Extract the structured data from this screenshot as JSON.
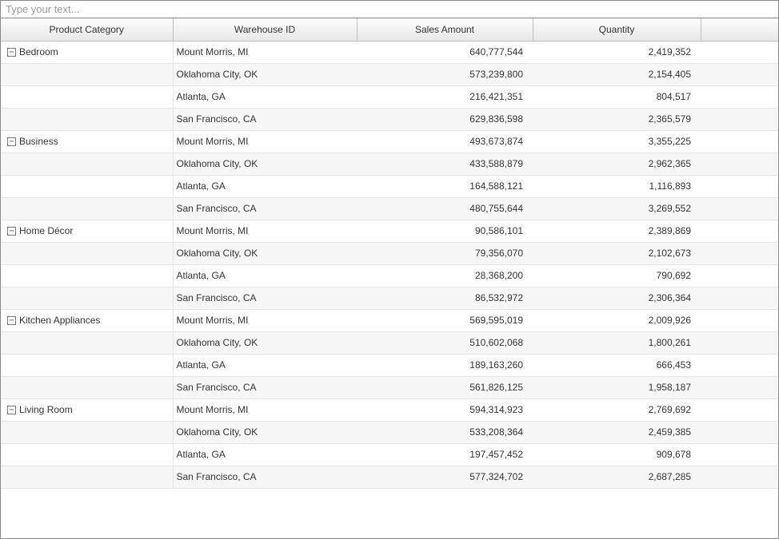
{
  "input": {
    "placeholder": "Type your text..."
  },
  "columns": {
    "category": "Product Category",
    "warehouse": "Warehouse ID",
    "sales": "Sales Amount",
    "qty": "Quantity",
    "extra": ""
  },
  "groups": [
    {
      "category": "Bedroom",
      "rows": [
        {
          "warehouse": "Mount Morris, MI",
          "sales": "640,777,544",
          "qty": "2,419,352"
        },
        {
          "warehouse": "Oklahoma City, OK",
          "sales": "573,239,800",
          "qty": "2,154,405"
        },
        {
          "warehouse": "Atlanta, GA",
          "sales": "216,421,351",
          "qty": "804,517"
        },
        {
          "warehouse": "San Francisco, CA",
          "sales": "629,836,598",
          "qty": "2,365,579"
        }
      ]
    },
    {
      "category": "Business",
      "rows": [
        {
          "warehouse": "Mount Morris, MI",
          "sales": "493,673,874",
          "qty": "3,355,225"
        },
        {
          "warehouse": "Oklahoma City, OK",
          "sales": "433,588,879",
          "qty": "2,962,365"
        },
        {
          "warehouse": "Atlanta, GA",
          "sales": "164,588,121",
          "qty": "1,116,893"
        },
        {
          "warehouse": "San Francisco, CA",
          "sales": "480,755,644",
          "qty": "3,269,552"
        }
      ]
    },
    {
      "category": "Home Décor",
      "rows": [
        {
          "warehouse": "Mount Morris, MI",
          "sales": "90,586,101",
          "qty": "2,389,869"
        },
        {
          "warehouse": "Oklahoma City, OK",
          "sales": "79,356,070",
          "qty": "2,102,673"
        },
        {
          "warehouse": "Atlanta, GA",
          "sales": "28,368,200",
          "qty": "790,692"
        },
        {
          "warehouse": "San Francisco, CA",
          "sales": "86,532,972",
          "qty": "2,306,364"
        }
      ]
    },
    {
      "category": "Kitchen Appliances",
      "rows": [
        {
          "warehouse": "Mount Morris, MI",
          "sales": "569,595,019",
          "qty": "2,009,926"
        },
        {
          "warehouse": "Oklahoma City, OK",
          "sales": "510,602,068",
          "qty": "1,800,261"
        },
        {
          "warehouse": "Atlanta, GA",
          "sales": "189,163,260",
          "qty": "666,453"
        },
        {
          "warehouse": "San Francisco, CA",
          "sales": "561,826,125",
          "qty": "1,958,187"
        }
      ]
    },
    {
      "category": "Living Room",
      "rows": [
        {
          "warehouse": "Mount Morris, MI",
          "sales": "594,314,923",
          "qty": "2,769,692"
        },
        {
          "warehouse": "Oklahoma City, OK",
          "sales": "533,208,364",
          "qty": "2,459,385"
        },
        {
          "warehouse": "Atlanta, GA",
          "sales": "197,457,452",
          "qty": "909,678"
        },
        {
          "warehouse": "San Francisco, CA",
          "sales": "577,324,702",
          "qty": "2,687,285"
        }
      ]
    }
  ]
}
